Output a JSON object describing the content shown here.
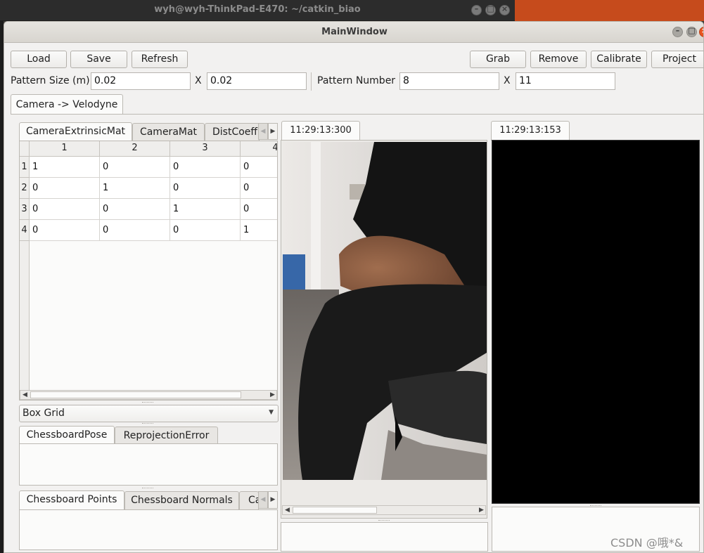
{
  "background_terminal": {
    "title": "wyh@wyh-ThinkPad-E470: ~/catkin_biao"
  },
  "window": {
    "title": "MainWindow"
  },
  "toolbar": {
    "load": "Load",
    "save": "Save",
    "refresh": "Refresh",
    "grab": "Grab",
    "remove": "Remove",
    "calibrate": "Calibrate",
    "project": "Project"
  },
  "pattern": {
    "size_label": "Pattern Size (m)",
    "size_x": "0.02",
    "x_sep": "X",
    "size_y": "0.02",
    "number_label": "Pattern Number",
    "number_x": "8",
    "number_y": "11"
  },
  "main_tab": "Camera -> Velodyne",
  "matrix_tabs": [
    "CameraExtrinsicMat",
    "CameraMat",
    "DistCoeff"
  ],
  "matrix": {
    "col_headers": [
      "1",
      "2",
      "3",
      "4"
    ],
    "rows": [
      {
        "header": "1",
        "values": [
          "1",
          "0",
          "0",
          "0"
        ]
      },
      {
        "header": "2",
        "values": [
          "0",
          "1",
          "0",
          "0"
        ]
      },
      {
        "header": "3",
        "values": [
          "0",
          "0",
          "1",
          "0"
        ]
      },
      {
        "header": "4",
        "values": [
          "0",
          "0",
          "0",
          "1"
        ]
      }
    ]
  },
  "box_grid": {
    "selected": "Box Grid"
  },
  "pose_tabs": [
    "ChessboardPose",
    "ReprojectionError"
  ],
  "points_tabs": [
    "Chessboard Points",
    "Chessboard Normals",
    "Ca"
  ],
  "camera_view": {
    "timestamp": "11:29:13:300"
  },
  "lidar_view": {
    "timestamp": "11:29:13:153"
  },
  "watermark": "CSDN @哦*&",
  "colors": {
    "accent": "#e95420",
    "window_bg": "#f2f1f0",
    "lidar_bg": "#000000"
  },
  "icons": [
    "minimize-icon",
    "maximize-icon",
    "close-icon",
    "arrow-left-icon",
    "arrow-right-icon",
    "chevron-down-icon"
  ]
}
